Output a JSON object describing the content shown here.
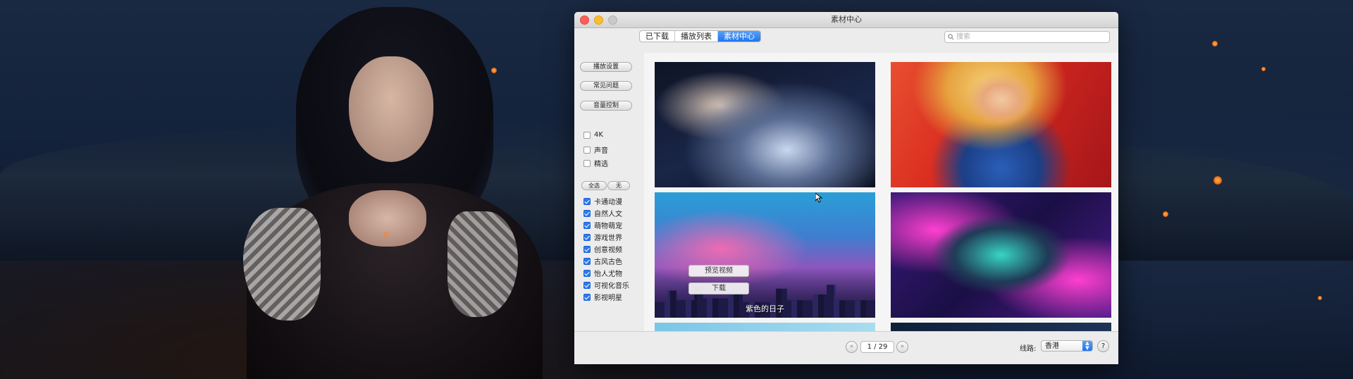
{
  "window": {
    "title": "素材中心"
  },
  "tabs": [
    {
      "label": "已下载",
      "active": false
    },
    {
      "label": "播放列表",
      "active": false
    },
    {
      "label": "素材中心",
      "active": true
    }
  ],
  "search": {
    "placeholder": "搜索",
    "value": ""
  },
  "sidebar": {
    "buttons": [
      "播放设置",
      "常见问题",
      "音量控制"
    ],
    "filters": [
      {
        "label": "4K",
        "checked": false
      },
      {
        "label": "声音",
        "checked": false
      },
      {
        "label": "精选",
        "checked": false
      }
    ],
    "select_all": "全选",
    "select_none": "无",
    "categories": [
      {
        "label": "卡通动漫",
        "checked": true
      },
      {
        "label": "自然人文",
        "checked": true
      },
      {
        "label": "萌物萌宠",
        "checked": true
      },
      {
        "label": "游戏世界",
        "checked": true
      },
      {
        "label": "创意视频",
        "checked": true
      },
      {
        "label": "古风古色",
        "checked": true
      },
      {
        "label": "怡人尤物",
        "checked": true
      },
      {
        "label": "可视化音乐",
        "checked": true
      },
      {
        "label": "影视明星",
        "checked": true
      }
    ]
  },
  "gallery": {
    "hovered_tile": {
      "preview_label": "预览视频",
      "download_label": "下载",
      "caption": "紫色的日子"
    }
  },
  "footer": {
    "prev_icon": "chevron-left-icon",
    "next_icon": "chevron-right-icon",
    "page_text": "1 / 29",
    "line_label": "线路:",
    "line_value": "香港",
    "help_label": "?"
  },
  "colors": {
    "accent": "#1f74f0",
    "checkbox_on": "#2a7af3"
  }
}
